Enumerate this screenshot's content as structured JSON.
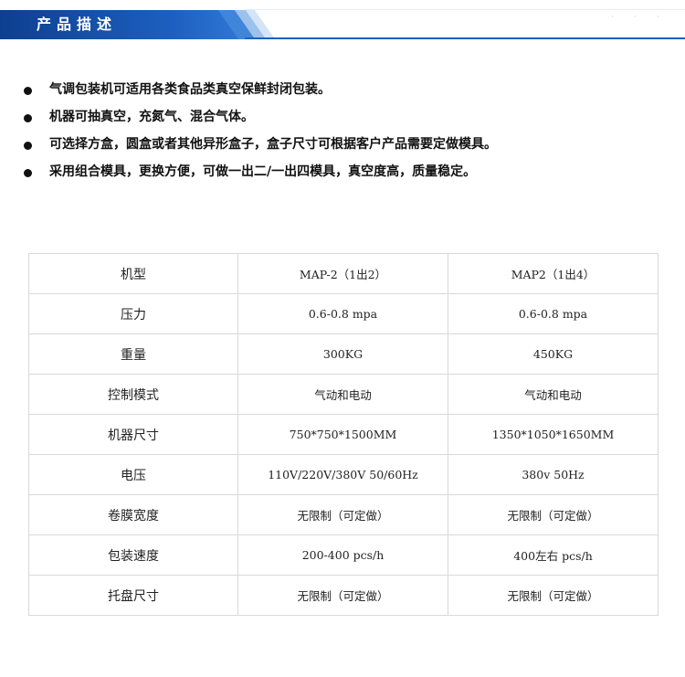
{
  "header": {
    "title": "产品描述",
    "dots": "· · ·",
    "colors": {
      "band": "#1d5fc0",
      "band_dark": "#0d3f8f",
      "accent_light": "#9cc1ec"
    }
  },
  "bullets": [
    "气调包装机可适用各类食品类真空保鲜封闭包装。",
    "机器可抽真空，充氮气、混合气体。",
    "可选择方盒，圆盒或者其他异形盒子，盒子尺寸可根据客户产品需要定做模具。",
    "采用组合模具，更换方便，可做一出二/一出四模具，真空度高，质量稳定。"
  ],
  "table": {
    "rows": [
      {
        "label": "机型",
        "a": "MAP-2（1出2）",
        "b": "MAP2（1出4）"
      },
      {
        "label": "压力",
        "a": "0.6-0.8 mpa",
        "b": "0.6-0.8 mpa"
      },
      {
        "label": "重量",
        "a": "300KG",
        "b": "450KG"
      },
      {
        "label": "控制模式",
        "a": "气动和电动",
        "b": "气动和电动"
      },
      {
        "label": "机器尺寸",
        "a": "750*750*1500MM",
        "b": "1350*1050*1650MM"
      },
      {
        "label": "电压",
        "a": "110V/220V/380V 50/60Hz",
        "b": "380v 50Hz"
      },
      {
        "label": "卷膜宽度",
        "a": "无限制（可定做）",
        "b": "无限制（可定做）"
      },
      {
        "label": "包装速度",
        "a": "200-400 pcs/h",
        "b": "400左右 pcs/h"
      },
      {
        "label": "托盘尺寸",
        "a": "无限制（可定做）",
        "b": "无限制（可定做）"
      }
    ]
  }
}
